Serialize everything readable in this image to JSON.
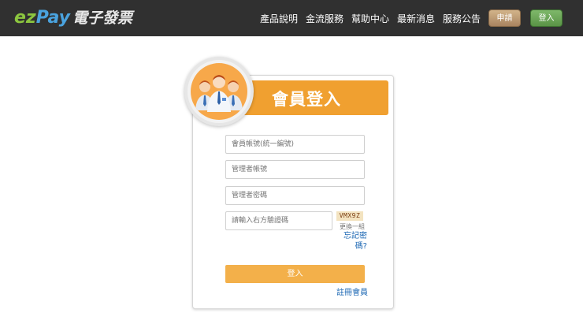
{
  "header": {
    "logo_ez": "ez",
    "logo_pay": "Pay",
    "logo_cn": "電子發票",
    "nav": [
      {
        "label": "產品說明"
      },
      {
        "label": "金流服務"
      },
      {
        "label": "幫助中心"
      },
      {
        "label": "最新消息"
      },
      {
        "label": "服務公告"
      }
    ],
    "apply_label": "申請",
    "login_label": "登入"
  },
  "login": {
    "title": "會員登入",
    "fields": {
      "member_account_placeholder": "會員帳號(統一編號)",
      "admin_account_placeholder": "管理者帳號",
      "admin_password_placeholder": "管理者密碼",
      "captcha_placeholder": "請輸入右方驗證碼"
    },
    "captcha_code": "VMX9Z",
    "captcha_refresh": "更換一組",
    "forgot_password": "忘記密碼?",
    "submit_label": "登入",
    "register_label": "註冊會員"
  },
  "colors": {
    "header_bg": "#303030",
    "accent_orange": "#f0a030",
    "apply_button": "#b8936a",
    "login_button": "#6aa556",
    "link_blue": "#1a66b3"
  },
  "icons": {
    "avatar": "member-group-icon"
  }
}
